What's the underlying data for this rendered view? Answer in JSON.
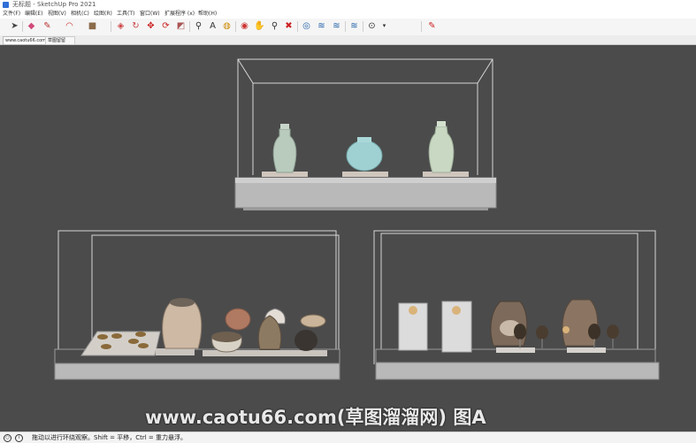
{
  "window": {
    "title": "无标题 - SketchUp Pro 2021"
  },
  "menu": [
    "文件(F)",
    "编辑(E)",
    "视图(V)",
    "相机(C)",
    "绘图(R)",
    "工具(T)",
    "窗口(W)",
    "扩展程序 (x)",
    "帮助(H)"
  ],
  "toolbar": {
    "icons": [
      "select-icon",
      "eraser-icon",
      "pencil-icon",
      "arc-icon",
      "rectangle-icon",
      "pushpull-icon",
      "followme-icon",
      "move-icon",
      "rotate-icon",
      "scale-icon",
      "tape-icon",
      "text-icon",
      "paint-icon",
      "orbit-icon",
      "pan-icon",
      "zoom-icon",
      "zoom-extents-icon",
      "warehouse-icon",
      "extension-warehouse-icon",
      "layout-icon",
      "components-icon",
      "styles-icon",
      "send-icon"
    ]
  },
  "tabs": {
    "tab1": "www.caotu66.com",
    "tab2": "草图留留"
  },
  "status": {
    "hint": "拖动以进行环绕观察。Shift = 平移，Ctrl = 重力悬浮。"
  },
  "watermark": "www.caotu66.com(草图溜溜网) 图A",
  "colors": {
    "viewport_bg": "#4b4b4b",
    "shelf": "#bdbdbd",
    "glass_edge": "#d8d8d8"
  }
}
